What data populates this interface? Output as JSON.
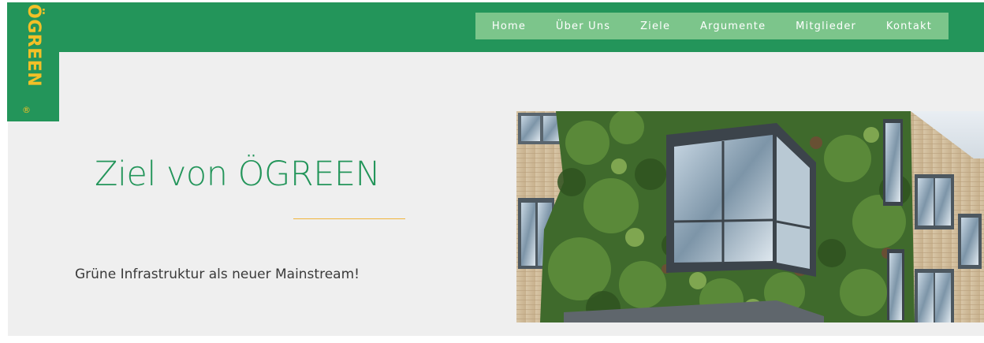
{
  "logo": {
    "text": "ÖGREEN",
    "reg": "®"
  },
  "nav": {
    "items": [
      {
        "label": "Home"
      },
      {
        "label": "Über Uns"
      },
      {
        "label": "Ziele"
      },
      {
        "label": "Argumente"
      },
      {
        "label": "Mitglieder"
      },
      {
        "label": "Kontakt"
      }
    ]
  },
  "hero": {
    "title": "Ziel von ÖGREEN",
    "subtitle": "Grüne Infrastruktur als neuer Mainstream!"
  },
  "colors": {
    "brand_green": "#23955a",
    "nav_bg": "#7cc58b",
    "logo_yellow": "#f2c027",
    "divider_orange": "#f0b43c",
    "content_bg": "#efefef"
  }
}
